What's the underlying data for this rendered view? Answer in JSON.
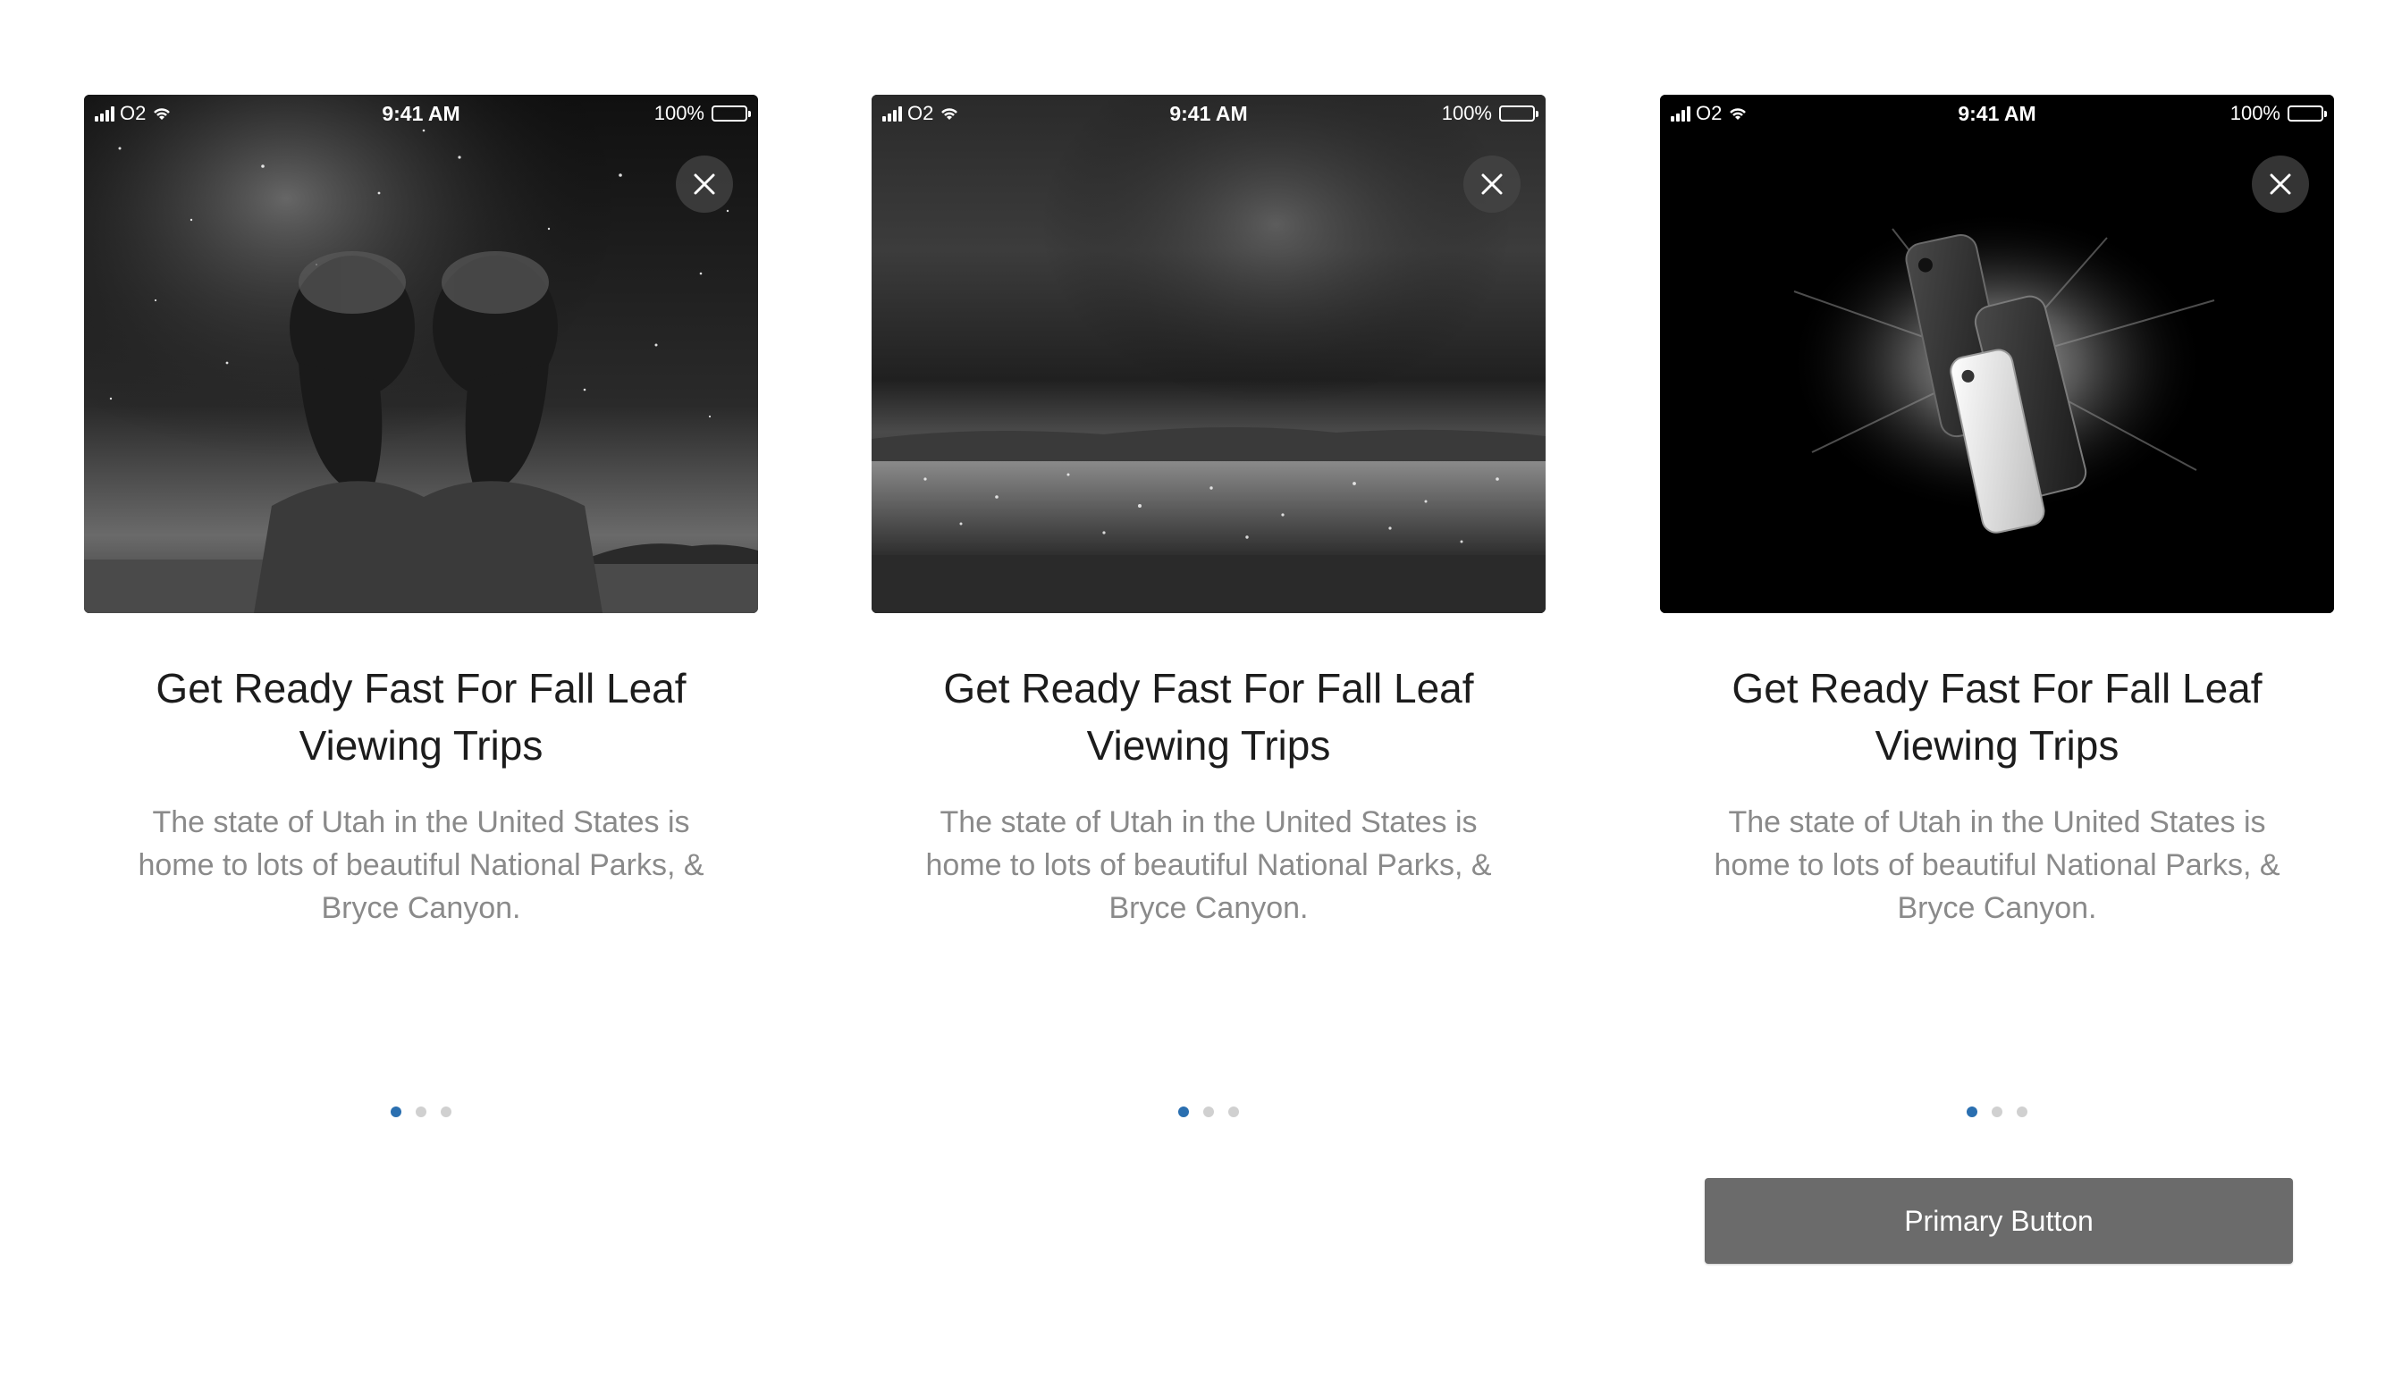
{
  "cards": [
    {
      "status_bar": {
        "carrier": "O2",
        "time": "9:41 AM",
        "battery": "100%"
      },
      "image_description": "bearded-men-under-starry-sky",
      "title": "Get Ready Fast For Fall Leaf Viewing Trips",
      "body": "The state of Utah in the United States is home to lots of beautiful National Parks, & Bryce Canyon.",
      "pager": {
        "count": 3,
        "active_index": 0
      }
    },
    {
      "status_bar": {
        "carrier": "O2",
        "time": "9:41 AM",
        "battery": "100%"
      },
      "image_description": "city-lights-under-night-sky",
      "title": "Get Ready Fast For Fall Leaf Viewing Trips",
      "body": "The state of Utah in the United States is home to lots of beautiful National Parks, & Bryce Canyon.",
      "pager": {
        "count": 3,
        "active_index": 0
      }
    },
    {
      "status_bar": {
        "carrier": "O2",
        "time": "9:41 AM",
        "battery": "100%"
      },
      "image_description": "smartphones-with-powder-explosion",
      "title": "Get Ready Fast For Fall Leaf Viewing Trips",
      "body": "The state of Utah in the United States is home to lots of beautiful National Parks, & Bryce Canyon.",
      "pager": {
        "count": 3,
        "active_index": 0
      },
      "primary_button_label": "Primary Button"
    }
  ],
  "icons": {
    "close": "close-icon",
    "signal": "signal-icon",
    "wifi": "wifi-icon",
    "battery": "battery-icon"
  },
  "colors": {
    "pager_active": "#2a6fb0",
    "pager_inactive": "#d0d0d0",
    "primary_button_bg": "#6b6b6b",
    "title": "#1c1c1c",
    "body": "#8a8a8a"
  }
}
